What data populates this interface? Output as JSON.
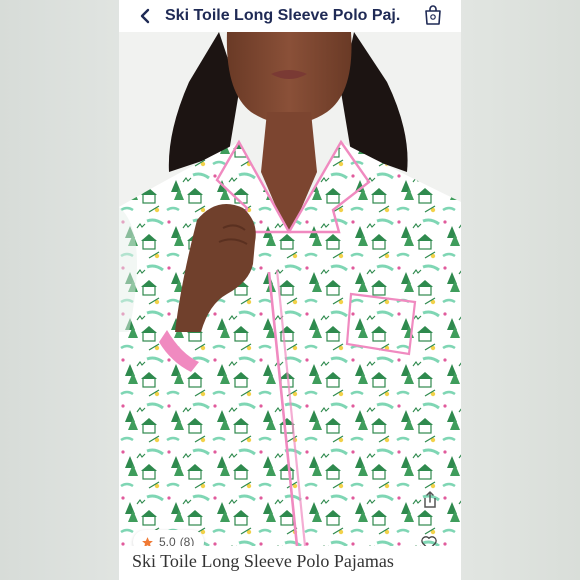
{
  "header": {
    "title": "Ski Toile Long Sleeve Polo Paj.",
    "back_icon": "chevron-left-icon",
    "bag_icon": "shopping-bag-icon"
  },
  "product": {
    "image_alt": "Model wearing green ski toile print long sleeve polo pajama top with pink piping",
    "rating_value": "5.0",
    "rating_count": "(8)",
    "share_icon": "share-icon",
    "favorite_icon": "heart-icon"
  },
  "footer": {
    "listing_title": "Ski Toile Long Sleeve Polo Pajamas"
  },
  "colors": {
    "title": "#1f2a55",
    "print_green": "#2f8a4e",
    "print_mint": "#7fd6b4",
    "piping_pink": "#f08ac0",
    "star": "#f07a35"
  }
}
